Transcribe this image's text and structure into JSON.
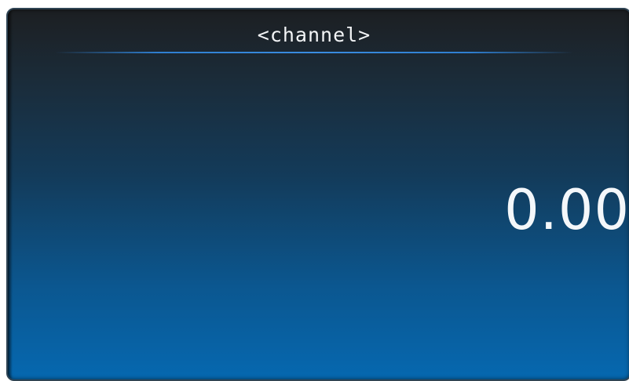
{
  "gauge": {
    "channel_label": "<channel>",
    "value": "0.00"
  },
  "colors": {
    "background_top": "#1c1f22",
    "background_bottom": "#0668b0",
    "divider": "#3a8de0",
    "text": "#f4f7fa"
  }
}
